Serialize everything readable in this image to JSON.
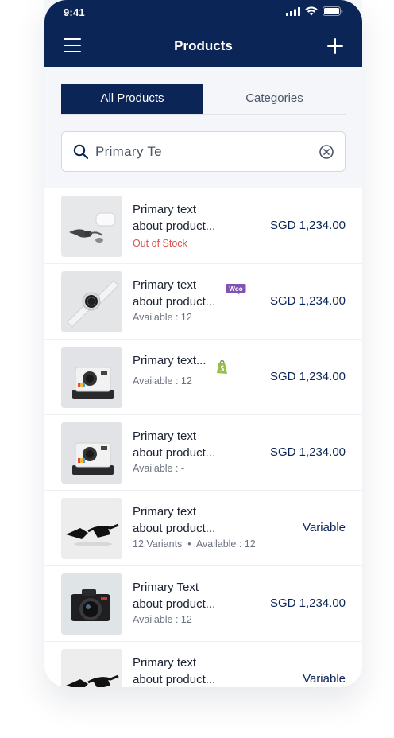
{
  "status_bar": {
    "time": "9:41"
  },
  "header": {
    "title": "Products"
  },
  "tabs": [
    {
      "label": "All Products",
      "active": true
    },
    {
      "label": "Categories",
      "active": false
    }
  ],
  "search": {
    "value": "Primary Te"
  },
  "products": [
    {
      "line1": "Primary text",
      "line2": "about product...",
      "availability": "Out of Stock",
      "price": "SGD 1,234.00",
      "image": "earbuds",
      "badge": ""
    },
    {
      "line1": "Primary text",
      "line2": "about product...",
      "availability": "Available : 12",
      "price": "SGD 1,234.00",
      "image": "smartwatch",
      "badge": "woocommerce"
    },
    {
      "line1": "Primary text...",
      "line2": "",
      "availability": "Available : 12",
      "price": "SGD 1,234.00",
      "image": "instant-camera",
      "badge": "shopify"
    },
    {
      "line1": "Primary text",
      "line2": "about product...",
      "availability": "Available : -",
      "price": "SGD 1,234.00",
      "image": "instant-camera",
      "badge": ""
    },
    {
      "line1": "Primary text",
      "line2": "about product...",
      "availability": "12 Variants  •  Available : 12",
      "price": "Variable",
      "image": "sunglasses",
      "badge": ""
    },
    {
      "line1": "Primary Text",
      "line2": "about product...",
      "availability": "Available : 12",
      "price": "SGD 1,234.00",
      "image": "dslr-camera",
      "badge": ""
    },
    {
      "line1": "Primary text",
      "line2": "about product...",
      "availability": "",
      "price": "Variable",
      "image": "sunglasses",
      "badge": ""
    }
  ],
  "badges": {
    "woocommerce": "Woo"
  },
  "colors": {
    "navy": "#0c2557",
    "out_of_stock": "#d9534f",
    "woo_purple": "#7f54b3",
    "shopify_green": "#95bf47"
  }
}
